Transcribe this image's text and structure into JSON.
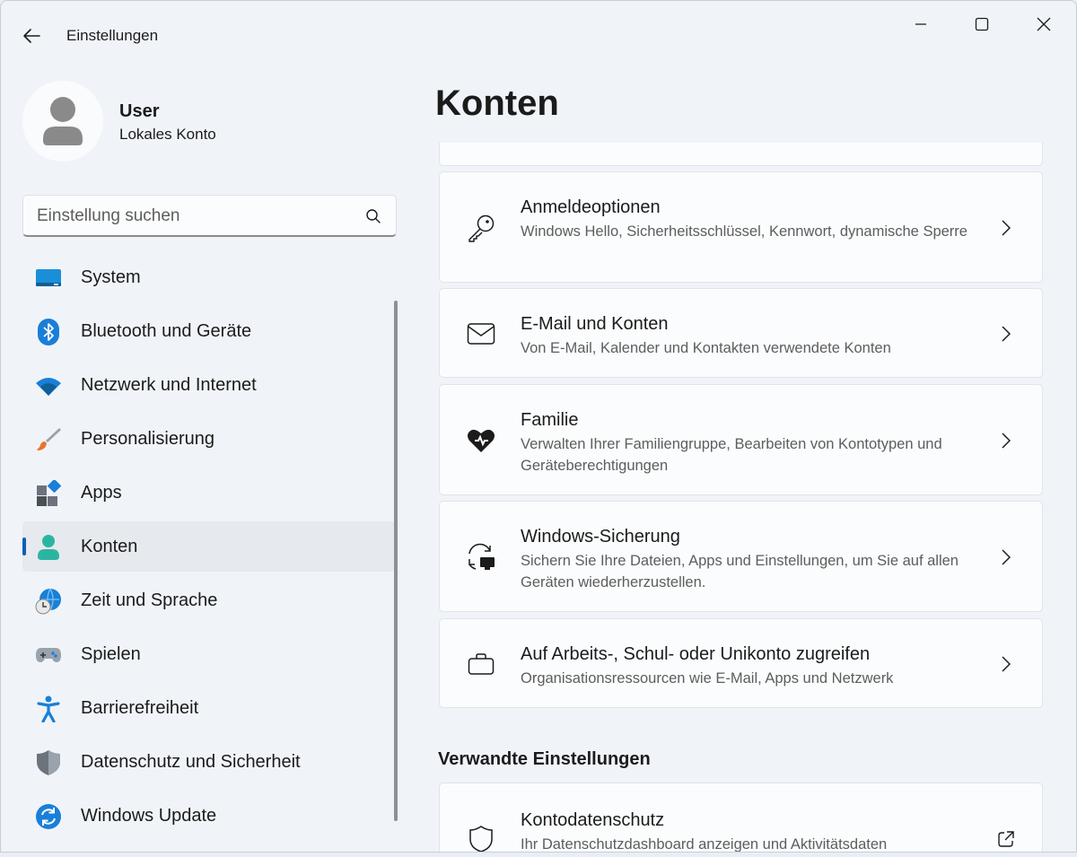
{
  "window": {
    "title": "Einstellungen"
  },
  "profile": {
    "name": "User",
    "account_type": "Lokales Konto"
  },
  "search": {
    "placeholder": "Einstellung suchen"
  },
  "nav": {
    "items": [
      {
        "label": "System",
        "icon": "system-icon",
        "active": false
      },
      {
        "label": "Bluetooth und Geräte",
        "icon": "bluetooth-icon",
        "active": false
      },
      {
        "label": "Netzwerk und Internet",
        "icon": "wifi-icon",
        "active": false
      },
      {
        "label": "Personalisierung",
        "icon": "brush-icon",
        "active": false
      },
      {
        "label": "Apps",
        "icon": "apps-icon",
        "active": false
      },
      {
        "label": "Konten",
        "icon": "person-icon",
        "active": true
      },
      {
        "label": "Zeit und Sprache",
        "icon": "globe-clock-icon",
        "active": false
      },
      {
        "label": "Spielen",
        "icon": "gamepad-icon",
        "active": false
      },
      {
        "label": "Barrierefreiheit",
        "icon": "accessibility-icon",
        "active": false
      },
      {
        "label": "Datenschutz und Sicherheit",
        "icon": "shield-icon",
        "active": false
      },
      {
        "label": "Windows Update",
        "icon": "update-icon",
        "active": false
      }
    ]
  },
  "main": {
    "title": "Konten",
    "cards": [
      {
        "title": "Anmeldeoptionen",
        "description": "Windows Hello, Sicherheitsschlüssel, Kennwort, dynamische Sperre",
        "icon": "key-icon"
      },
      {
        "title": "E-Mail und Konten",
        "description": "Von E-Mail, Kalender und Kontakten verwendete Konten",
        "icon": "mail-icon"
      },
      {
        "title": "Familie",
        "description": "Verwalten Ihrer Familiengruppe, Bearbeiten von Kontotypen und Geräteberechtigungen",
        "icon": "family-heart-icon"
      },
      {
        "title": "Windows-Sicherung",
        "description": "Sichern Sie Ihre Dateien, Apps und Einstellungen, um Sie auf allen Geräten wiederherzustellen.",
        "icon": "backup-icon"
      },
      {
        "title": "Auf Arbeits-, Schul- oder Unikonto zugreifen",
        "description": "Organisationsressourcen wie E-Mail, Apps und Netzwerk",
        "icon": "briefcase-icon"
      }
    ],
    "related_title": "Verwandte Einstellungen",
    "related_cards": [
      {
        "title": "Kontodatenschutz",
        "description": "Ihr Datenschutzdashboard anzeigen und Aktivitätsdaten",
        "icon": "shield-outline-icon"
      }
    ]
  },
  "colors": {
    "accent": "#0a5fb5",
    "window_bg": "#f0f4f9",
    "card_bg": "#fbfcfd"
  }
}
